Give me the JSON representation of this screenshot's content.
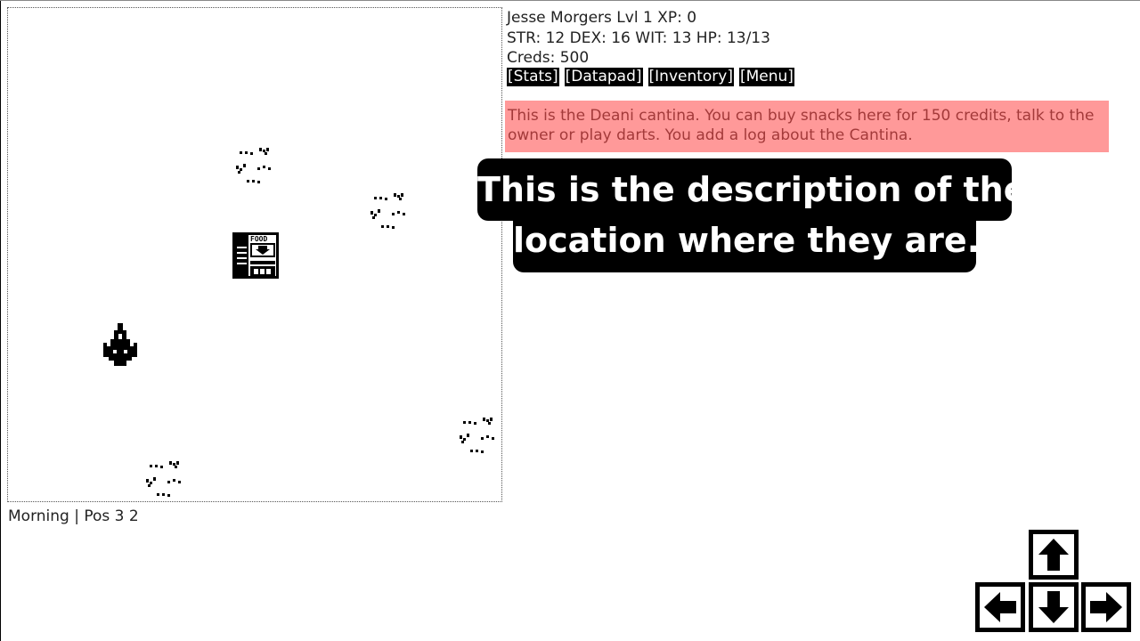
{
  "player": {
    "stats_line1": "Jesse Morgers Lvl 1 XP: 0",
    "stats_line2": "STR: 12 DEX: 16 WIT: 13 HP: 13/13",
    "stats_line3": "Creds: 500"
  },
  "menu": {
    "stats": "[Stats]",
    "datapad": "[Datapad]",
    "inventory": "[Inventory]",
    "menu": "[Menu]"
  },
  "location": {
    "description": "This is the Deani cantina. You can buy snacks here for 150 credits, talk to the owner or play darts. You add a log about the Cantina."
  },
  "caption": {
    "line1": "This is the description of the",
    "line2": "location where they are."
  },
  "status": {
    "text": "Morning | Pos 3 2"
  },
  "sprites": {
    "building_sign": "FOOD",
    "ship_icon": "ship-icon",
    "grass_icon": "grass-tuft-icon",
    "building_icon": "cantina-building-icon"
  },
  "colors": {
    "description_bg": "#ff9999",
    "description_text": "#a33a3a",
    "caption_bg": "#000000",
    "button_bg": "#000000"
  },
  "controls": {
    "up": "arrow-up-icon",
    "down": "arrow-down-icon",
    "left": "arrow-left-icon",
    "right": "arrow-right-icon"
  }
}
